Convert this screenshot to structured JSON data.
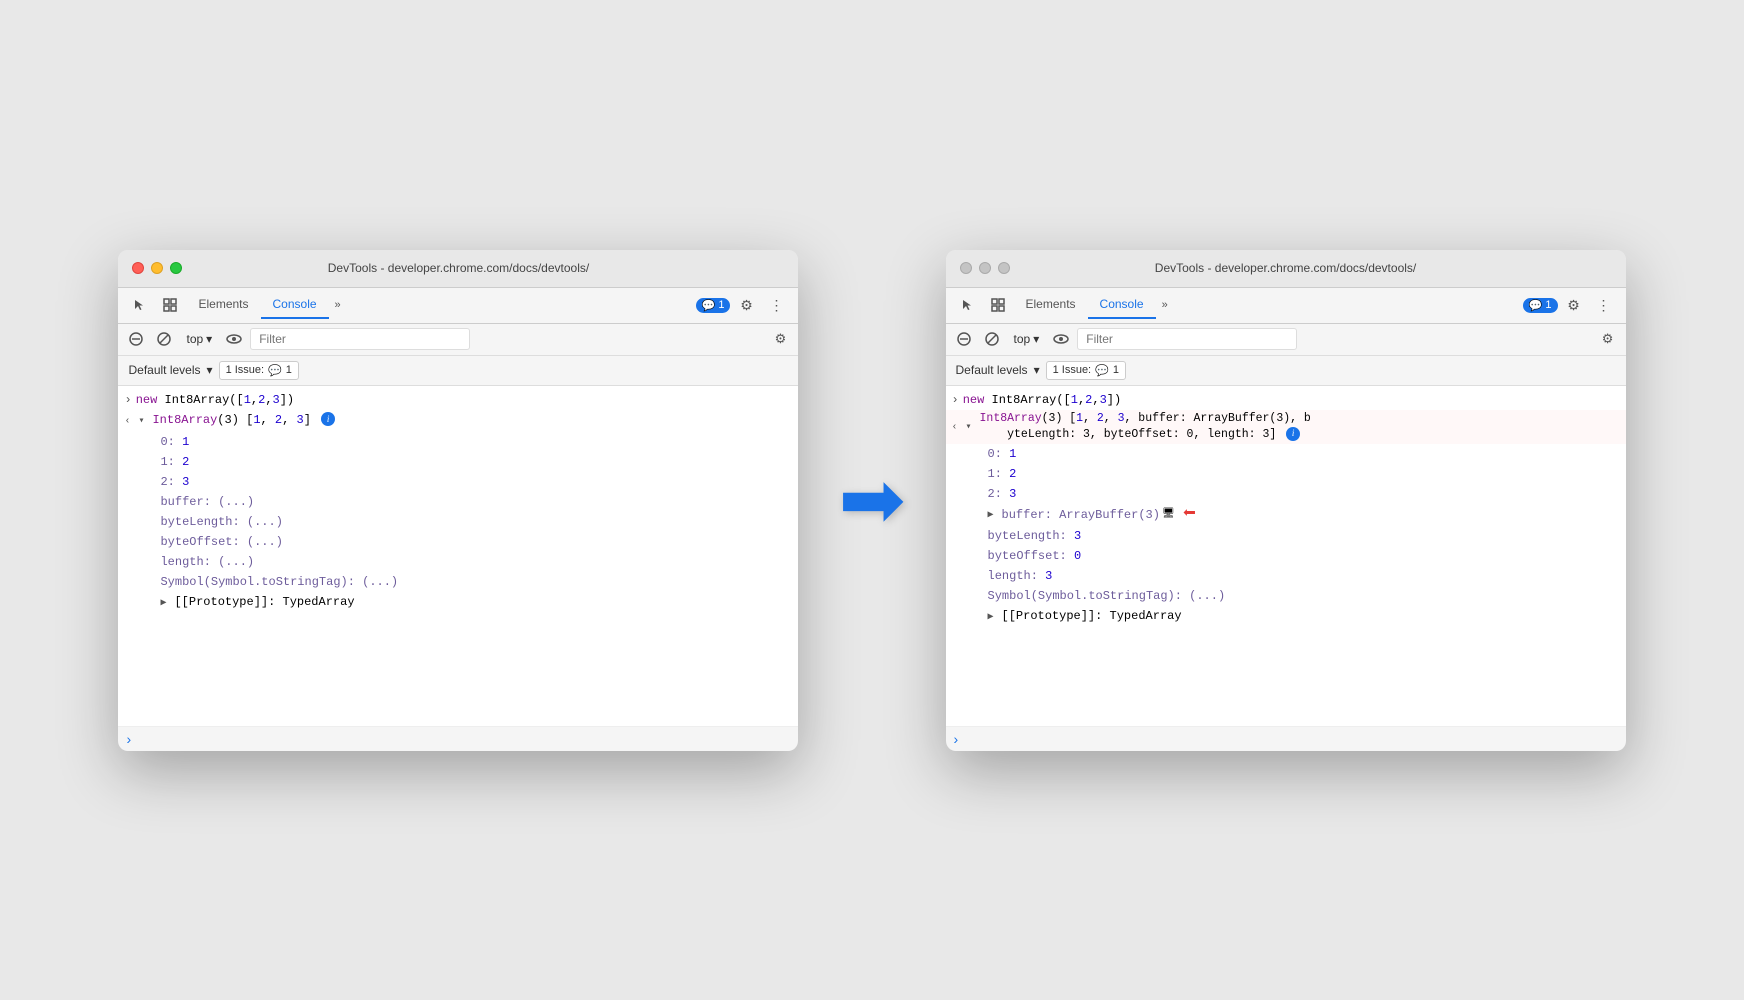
{
  "windows": [
    {
      "id": "left",
      "titlebar": {
        "title": "DevTools - developer.chrome.com/docs/devtools/",
        "active": true
      },
      "tabs": [
        {
          "label": "Elements",
          "active": false
        },
        {
          "label": "Console",
          "active": true
        }
      ],
      "tab_more": "»",
      "badge": {
        "count": "1",
        "icon": "💬"
      },
      "top_label": "top",
      "filter_placeholder": "Filter",
      "default_levels": "Default levels",
      "issues_label": "1 Issue:",
      "issues_count": "1",
      "console_lines": [
        {
          "type": "command",
          "text": "new Int8Array([1,2,3])",
          "indent": 0
        },
        {
          "type": "expand",
          "text": "Int8Array(3) [1, 2, 3]",
          "indent": 0,
          "has_info": true
        },
        {
          "type": "prop",
          "text": "0: 1",
          "indent": 1
        },
        {
          "type": "prop",
          "text": "1: 2",
          "indent": 1
        },
        {
          "type": "prop",
          "text": "2: 3",
          "indent": 1
        },
        {
          "type": "prop-lazy",
          "text": "buffer: (...)",
          "indent": 1
        },
        {
          "type": "prop-lazy",
          "text": "byteLength: (...)",
          "indent": 1
        },
        {
          "type": "prop-lazy",
          "text": "byteOffset: (...)",
          "indent": 1
        },
        {
          "type": "prop-lazy",
          "text": "length: (...)",
          "indent": 1
        },
        {
          "type": "prop-lazy",
          "text": "Symbol(Symbol.toStringTag): (...)",
          "indent": 1
        },
        {
          "type": "expand-proto",
          "text": "[[Prototype]]: TypedArray",
          "indent": 1
        }
      ]
    },
    {
      "id": "right",
      "titlebar": {
        "title": "DevTools - developer.chrome.com/docs/devtools/",
        "active": false
      },
      "tabs": [
        {
          "label": "Elements",
          "active": false
        },
        {
          "label": "Console",
          "active": true
        }
      ],
      "tab_more": "»",
      "badge": {
        "count": "1",
        "icon": "💬"
      },
      "top_label": "top",
      "filter_placeholder": "Filter",
      "default_levels": "Default levels",
      "issues_label": "1 Issue:",
      "issues_count": "1",
      "console_lines": [
        {
          "type": "command",
          "text": "new Int8Array([1,2,3])",
          "indent": 0
        },
        {
          "type": "expand-red",
          "text": "Int8Array(3) [1, 2, 3, buffer: ArrayBuffer(3), byteLength: 3, byteOffset: 0, length: 3]",
          "indent": 0,
          "has_info": true,
          "red_arrow": true
        },
        {
          "type": "prop",
          "text": "0: 1",
          "indent": 1
        },
        {
          "type": "prop",
          "text": "1: 2",
          "indent": 1
        },
        {
          "type": "prop",
          "text": "2: 3",
          "indent": 1
        },
        {
          "type": "expand-red-buffer",
          "text": "buffer: ArrayBuffer(3)",
          "indent": 1,
          "red_arrow": true
        },
        {
          "type": "prop",
          "text": "byteLength: 3",
          "indent": 1
        },
        {
          "type": "prop",
          "text": "byteOffset: 0",
          "indent": 1
        },
        {
          "type": "prop",
          "text": "length: 3",
          "indent": 1
        },
        {
          "type": "prop-lazy",
          "text": "Symbol(Symbol.toStringTag): (...)",
          "indent": 1
        },
        {
          "type": "expand-proto",
          "text": "[[Prototype]]: TypedArray",
          "indent": 1
        }
      ]
    }
  ],
  "arrow": "→"
}
